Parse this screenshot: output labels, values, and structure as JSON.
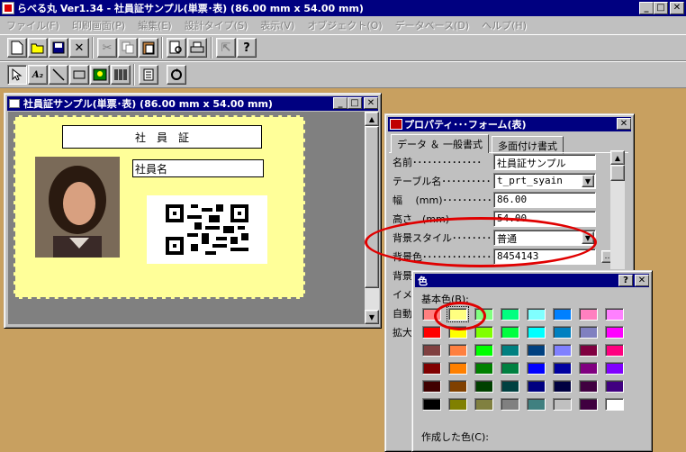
{
  "app": {
    "title": "らべる丸 Ver1.34 - 社員証サンプル(単票･表) (86.00 mm x 54.00 mm)"
  },
  "menu": [
    "ファイル(F)",
    "印刷画面(P)",
    "編集(E)",
    "設計タイプ(S)",
    "表示(V)",
    "オブジェクト(O)",
    "データベース(D)",
    "ヘルプ(H)"
  ],
  "document": {
    "title": "社員証サンプル(単票･表) (86.00 mm x 54.00 mm)",
    "header_text": "社　員　証",
    "name_text": "社員名"
  },
  "properties": {
    "title": "プロパティ･･･フォーム(表)",
    "tabs": [
      "データ ＆ 一般書式",
      "多面付け書式"
    ],
    "rows": [
      {
        "label": "名前･･････････････",
        "value": "社員証サンプル"
      },
      {
        "label": "テーブル名･･････････",
        "value": "t_prt_syain"
      },
      {
        "label": "幅　 (mm)･･････････",
        "value": "86.00"
      },
      {
        "label": "高さ　(mm)･････････",
        "value": "54.00"
      },
      {
        "label": "背景スタイル･････････",
        "value": "普通"
      },
      {
        "label": "背景色･･･････････････",
        "value": "8454143"
      }
    ],
    "more_labels": [
      "背景",
      "イメージ",
      "自動",
      "拡大"
    ]
  },
  "color_dialog": {
    "title": "色",
    "basic_label": "基本色(B):",
    "custom_label": "作成した色(C):",
    "colors": [
      [
        "#ff8080",
        "#ffff80",
        "#80ff80",
        "#00ff80",
        "#80ffff",
        "#0080ff",
        "#ff80c0",
        "#ff80ff"
      ],
      [
        "#ff0000",
        "#ffff00",
        "#80ff00",
        "#00ff40",
        "#00ffff",
        "#0080c0",
        "#8080c0",
        "#ff00ff"
      ],
      [
        "#804040",
        "#ff8040",
        "#00ff00",
        "#008080",
        "#004080",
        "#8080ff",
        "#800040",
        "#ff0080"
      ],
      [
        "#800000",
        "#ff8000",
        "#008000",
        "#008040",
        "#0000ff",
        "#0000a0",
        "#800080",
        "#8000ff"
      ],
      [
        "#400000",
        "#804000",
        "#004000",
        "#004040",
        "#000080",
        "#000040",
        "#400040",
        "#400080"
      ],
      [
        "#000000",
        "#808000",
        "#808040",
        "#808080",
        "#408080",
        "#c0c0c0",
        "#400040",
        "#ffffff"
      ]
    ]
  }
}
